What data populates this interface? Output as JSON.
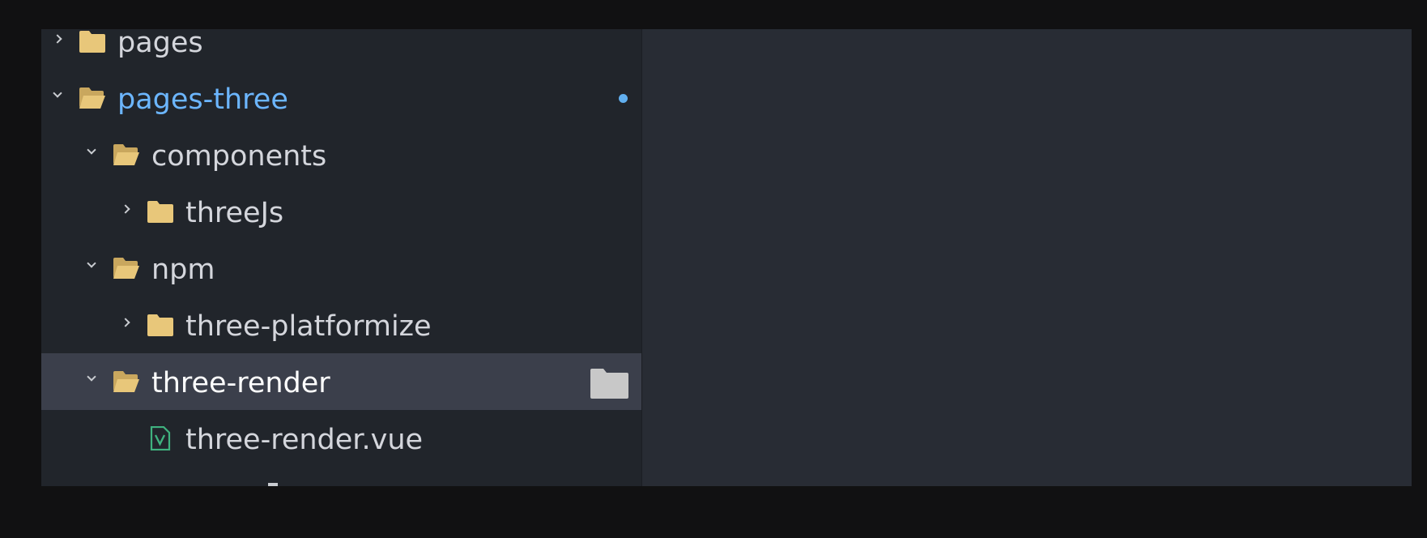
{
  "explorer": {
    "items": [
      {
        "label": "pages",
        "kind": "folder",
        "expanded": false,
        "depth": 0
      },
      {
        "label": "pages-three",
        "kind": "folder",
        "expanded": true,
        "depth": 0,
        "highlighted": true,
        "modified_indicator": true
      },
      {
        "label": "components",
        "kind": "folder",
        "expanded": true,
        "depth": 1
      },
      {
        "label": "threeJs",
        "kind": "folder",
        "expanded": false,
        "depth": 2
      },
      {
        "label": "npm",
        "kind": "folder",
        "expanded": true,
        "depth": 1
      },
      {
        "label": "three-platformize",
        "kind": "folder",
        "expanded": false,
        "depth": 2
      },
      {
        "label": "three-render",
        "kind": "folder",
        "expanded": true,
        "depth": 1,
        "selected": true
      },
      {
        "label": "three-render.vue",
        "kind": "file",
        "icon": "vue-file-icon",
        "depth": 2
      }
    ]
  },
  "colors": {
    "background": "#111112",
    "sidebar": "#21252b",
    "editor": "#282c34",
    "selected_row": "#3b3f4b",
    "accent": "#6cb6ff",
    "folder": "#e8c77a",
    "vue_icon": "#3fb27f"
  }
}
